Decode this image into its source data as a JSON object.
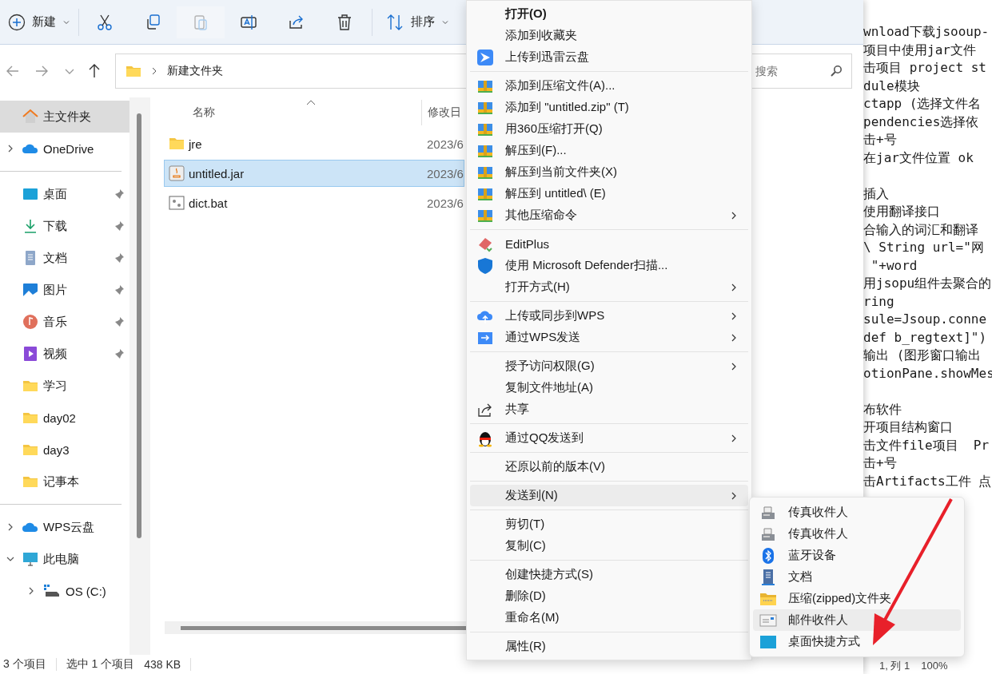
{
  "toolbar": {
    "new_label": "新建",
    "sort_label": "排序",
    "actions": [
      {
        "disabled": false
      },
      {
        "disabled": false
      },
      {
        "disabled": true
      },
      {
        "disabled": false
      },
      {
        "disabled": false
      },
      {
        "disabled": false
      }
    ]
  },
  "address": {
    "path": "新建文件夹"
  },
  "search": {
    "placeholder": "搜索"
  },
  "sidebar": {
    "sections": [
      [
        {
          "label": "主文件夹",
          "selected": true,
          "pinned": false
        },
        {
          "label": "OneDrive",
          "selected": false,
          "pinned": false,
          "expanded": false
        }
      ],
      [
        {
          "label": "桌面",
          "selected": false,
          "pinned": true
        },
        {
          "label": "下载",
          "selected": false,
          "pinned": true
        },
        {
          "label": "文档",
          "selected": false,
          "pinned": true
        },
        {
          "label": "图片",
          "selected": false,
          "pinned": true
        },
        {
          "label": "音乐",
          "selected": false,
          "pinned": true
        },
        {
          "label": "视频",
          "selected": false,
          "pinned": true
        },
        {
          "label": "学习",
          "selected": false,
          "pinned": false
        },
        {
          "label": "day02",
          "selected": false,
          "pinned": false
        },
        {
          "label": "day3",
          "selected": false,
          "pinned": false
        },
        {
          "label": "记事本",
          "selected": false,
          "pinned": false
        }
      ],
      [
        {
          "label": "WPS云盘",
          "selected": false,
          "pinned": false,
          "expanded": false
        },
        {
          "label": "此电脑",
          "selected": false,
          "pinned": false,
          "expanded": true,
          "children": [
            {
              "label": "OS (C:)",
              "selected": false,
              "pinned": false,
              "expanded": false
            }
          ]
        }
      ]
    ]
  },
  "files": {
    "columns": [
      "名称",
      "修改日"
    ],
    "rows": [
      {
        "name": "jre",
        "date": "2023/6",
        "kind": "folder",
        "selected": false
      },
      {
        "name": "untitled.jar",
        "date": "2023/6",
        "kind": "jar",
        "selected": true
      },
      {
        "name": "dict.bat",
        "date": "2023/6",
        "kind": "bat",
        "selected": false
      }
    ]
  },
  "status_bar": {
    "count": "3 个项目",
    "selection": "选中 1 个项目",
    "size": "438 KB"
  },
  "notepad": {
    "paragraphs": [
      [
        "wnload下载jsooup-",
        "项目中使用jar文件",
        "击项目 project st",
        "dule模块",
        "ctapp (选择文件名",
        "pendencies选择依",
        "击+号",
        "在jar文件位置 ok"
      ],
      [
        "插入",
        "使用翻译接口",
        "合输入的词汇和翻译",
        "\\ String url=\"网",
        " \"+word",
        "用jsopu组件去聚合的",
        "ring",
        "sule=Jsoup.conne",
        "def b_regtext]\")",
        "输出 (图形窗口输出",
        "otionPane.showMes"
      ],
      [
        "布软件",
        "开项目结构窗口",
        "击文件file项目  Pr",
        "击+号",
        "击Artifacts工件 点"
      ]
    ],
    "status": "1, 列 1",
    "zoom": "100%"
  },
  "context_menu": {
    "groups": [
      [
        {
          "label": "打开(O)",
          "default": true,
          "submenu": false,
          "selected": false
        },
        {
          "label": "添加到收藏夹",
          "default": false,
          "submenu": false,
          "selected": false
        },
        {
          "label": "上传到迅雷云盘",
          "default": false,
          "submenu": false,
          "selected": false
        }
      ],
      [
        {
          "label": "添加到压缩文件(A)...",
          "default": false,
          "submenu": false,
          "selected": false
        },
        {
          "label": "添加到 \"untitled.zip\" (T)",
          "default": false,
          "submenu": false,
          "selected": false
        },
        {
          "label": "用360压缩打开(Q)",
          "default": false,
          "submenu": false,
          "selected": false
        },
        {
          "label": "解压到(F)...",
          "default": false,
          "submenu": false,
          "selected": false
        },
        {
          "label": "解压到当前文件夹(X)",
          "default": false,
          "submenu": false,
          "selected": false
        },
        {
          "label": "解压到 untitled\\ (E)",
          "default": false,
          "submenu": false,
          "selected": false
        },
        {
          "label": "其他压缩命令",
          "default": false,
          "submenu": true,
          "selected": false
        }
      ],
      [
        {
          "label": "EditPlus",
          "default": false,
          "submenu": false,
          "selected": false
        },
        {
          "label": "使用 Microsoft Defender扫描...",
          "default": false,
          "submenu": false,
          "selected": false
        },
        {
          "label": "打开方式(H)",
          "default": false,
          "submenu": true,
          "selected": false
        }
      ],
      [
        {
          "label": "上传或同步到WPS",
          "default": false,
          "submenu": true,
          "selected": false
        },
        {
          "label": "通过WPS发送",
          "default": false,
          "submenu": true,
          "selected": false
        }
      ],
      [
        {
          "label": "授予访问权限(G)",
          "default": false,
          "submenu": true,
          "selected": false
        },
        {
          "label": "复制文件地址(A)",
          "default": false,
          "submenu": false,
          "selected": false
        },
        {
          "label": "共享",
          "default": false,
          "submenu": false,
          "selected": false
        }
      ],
      [
        {
          "label": "通过QQ发送到",
          "default": false,
          "submenu": true,
          "selected": false
        }
      ],
      [
        {
          "label": "还原以前的版本(V)",
          "default": false,
          "submenu": false,
          "selected": false
        }
      ],
      [
        {
          "label": "发送到(N)",
          "default": false,
          "submenu": true,
          "selected": true
        }
      ],
      [
        {
          "label": "剪切(T)",
          "default": false,
          "submenu": false,
          "selected": false
        },
        {
          "label": "复制(C)",
          "default": false,
          "submenu": false,
          "selected": false
        }
      ],
      [
        {
          "label": "创建快捷方式(S)",
          "default": false,
          "submenu": false,
          "selected": false
        },
        {
          "label": "删除(D)",
          "default": false,
          "submenu": false,
          "selected": false
        },
        {
          "label": "重命名(M)",
          "default": false,
          "submenu": false,
          "selected": false
        }
      ],
      [
        {
          "label": "属性(R)",
          "default": false,
          "submenu": false,
          "selected": false
        }
      ]
    ]
  },
  "send_to_menu": {
    "items": [
      {
        "label": "传真收件人",
        "selected": false
      },
      {
        "label": "传真收件人",
        "selected": false
      },
      {
        "label": "蓝牙设备",
        "selected": false
      },
      {
        "label": "文档",
        "selected": false
      },
      {
        "label": "压缩(zipped)文件夹",
        "selected": false
      },
      {
        "label": "邮件收件人",
        "selected": true
      },
      {
        "label": "桌面快捷方式",
        "selected": false
      }
    ]
  }
}
